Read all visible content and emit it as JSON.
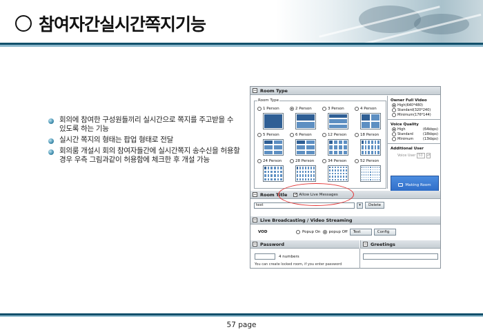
{
  "slide": {
    "title": "참여자간실시간쪽지기능",
    "page": "57 page"
  },
  "bullets": [
    "회의에 참여한 구성원들끼리 실시간으로 쪽지를 주고받을 수 있도록 하는 기능",
    "실시간 쪽지의 형태는 팝업 형태로 전달",
    "회의룸 개설시 회의 참여자들간에 실시간쪽지 송수신을 허용할 경우 우측 그림과같이 허용함에 체크한 후 개설 가능"
  ],
  "app": {
    "room_type_header": "Room Type",
    "room_type_group": "Room Type",
    "room_options": [
      {
        "label": "1 Person",
        "selected": false,
        "cols": 1,
        "rows": 1
      },
      {
        "label": "2 Person",
        "selected": true,
        "cols": 1,
        "rows": 2
      },
      {
        "label": "3 Person",
        "selected": false,
        "cols": 1,
        "rows": 3
      },
      {
        "label": "4 Person",
        "selected": false,
        "cols": 2,
        "rows": 2
      },
      {
        "label": "5 Person",
        "selected": false,
        "cols": 2,
        "rows": 3
      },
      {
        "label": "6 Person",
        "selected": false,
        "cols": 2,
        "rows": 3
      },
      {
        "label": "12 Person",
        "selected": false,
        "cols": 4,
        "rows": 3
      },
      {
        "label": "18 Person",
        "selected": false,
        "cols": 6,
        "rows": 3
      },
      {
        "label": "24 Person",
        "selected": false,
        "cols": 6,
        "rows": 4
      },
      {
        "label": "28 Person",
        "selected": false,
        "cols": 7,
        "rows": 4
      },
      {
        "label": "34 Person",
        "selected": false,
        "cols": 7,
        "rows": 5
      },
      {
        "label": "52 Person",
        "selected": false,
        "cols": 9,
        "rows": 6
      }
    ],
    "owner_video": {
      "title": "Owner Full Video",
      "options": [
        {
          "label": "High(640*480)",
          "selected": true
        },
        {
          "label": "Standard(320*240)",
          "selected": false
        },
        {
          "label": "Minimum(176*144)",
          "selected": false
        }
      ]
    },
    "voice_quality": {
      "title": "Voice Quality",
      "options": [
        {
          "label": "High",
          "value": "(64kbps)",
          "selected": true
        },
        {
          "label": "Standard",
          "value": "(18kbps)",
          "selected": false
        },
        {
          "label": "Minimum",
          "value": "(13kbps)",
          "selected": false
        }
      ]
    },
    "additional_user": {
      "title": "Additional User",
      "voice_user_label": "Voice User",
      "voice_user_value": "50"
    },
    "making_room_button": "Making Room",
    "room_title_header": "Room Title",
    "allow_live_messages": "Allow Live Messages",
    "room_title_value": "test",
    "delete_button": "Delete",
    "live_header": "Live Broadcasting / Video Streaming",
    "vod_label": "VOD",
    "popup_on": "Popup On",
    "popup_off": "popup Off",
    "test_button": "Test",
    "config_button": "Config",
    "password_header": "Password",
    "password_hint": "4 numbers",
    "password_note": "You can create locked room, if you enter password",
    "greetings_header": "Greetings"
  },
  "colors": {
    "header_rule": "#12506b",
    "oval": "#e33434",
    "making_room": "#2a68c4"
  }
}
